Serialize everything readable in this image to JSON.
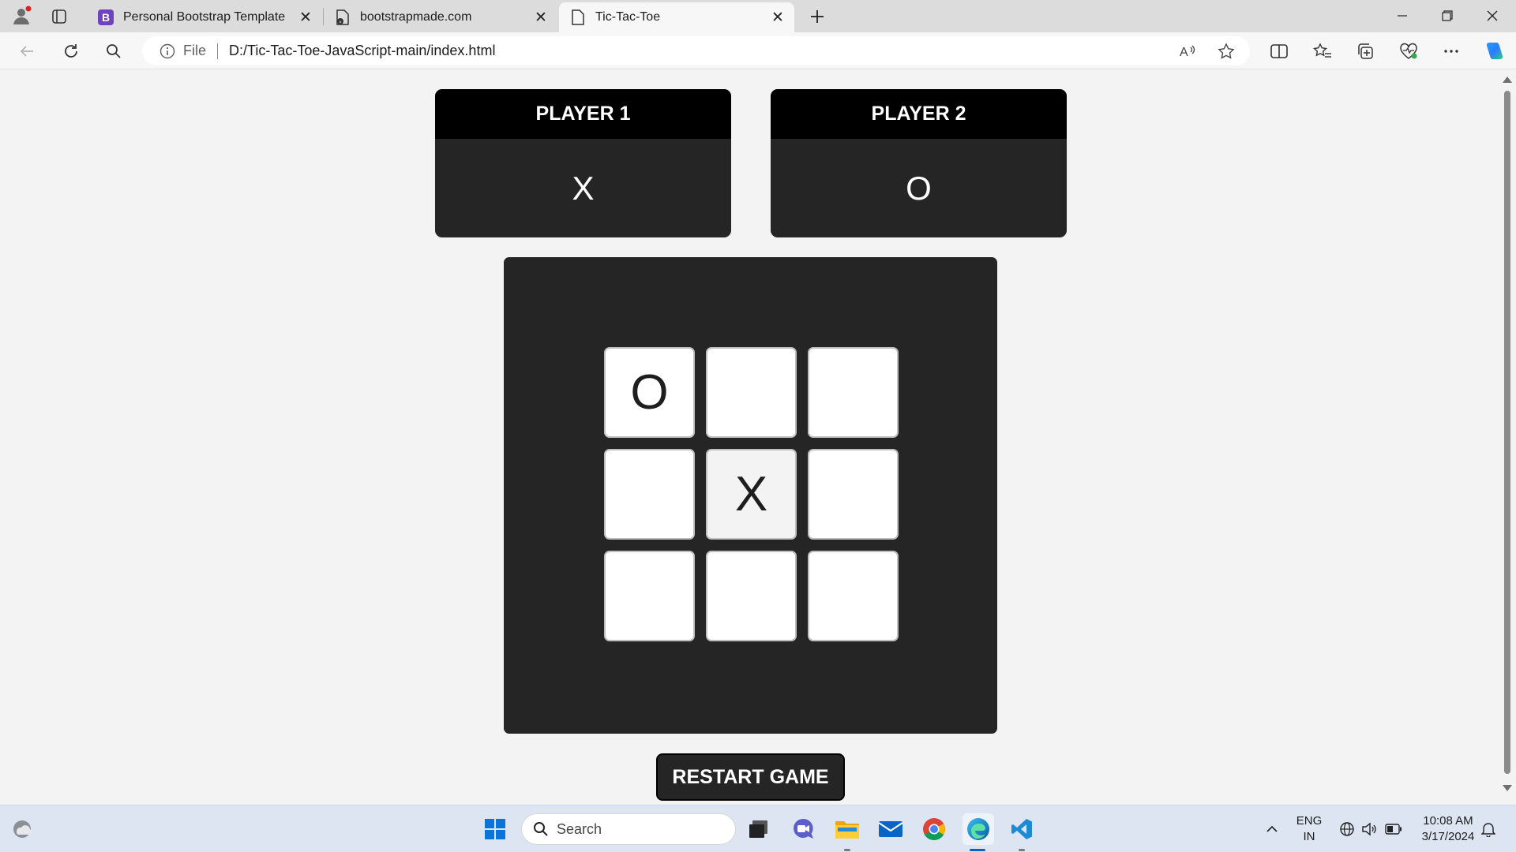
{
  "browser": {
    "tabs": [
      {
        "title": "Personal Bootstrap Template",
        "favicon": "bootstrap-icon"
      },
      {
        "title": "bootstrapmade.com",
        "favicon": "page-error-icon"
      },
      {
        "title": "Tic-Tac-Toe",
        "favicon": "page-icon",
        "active": true
      }
    ],
    "address": {
      "scheme_label": "File",
      "url": "D:/Tic-Tac-Toe-JavaScript-main/index.html"
    }
  },
  "game": {
    "players": [
      {
        "label": "PLAYER 1",
        "symbol": "X"
      },
      {
        "label": "PLAYER 2",
        "symbol": "O"
      }
    ],
    "board": [
      "O",
      "",
      "",
      "",
      "X",
      "",
      "",
      "",
      ""
    ],
    "restart_label": "RESTART GAME"
  },
  "taskbar": {
    "search_label": "Search",
    "lang": "ENG",
    "region": "IN",
    "time": "10:08 AM",
    "date": "3/17/2024"
  },
  "colors": {
    "card_bg": "#252525",
    "card_head": "#000000",
    "accent": "#0067c0"
  }
}
